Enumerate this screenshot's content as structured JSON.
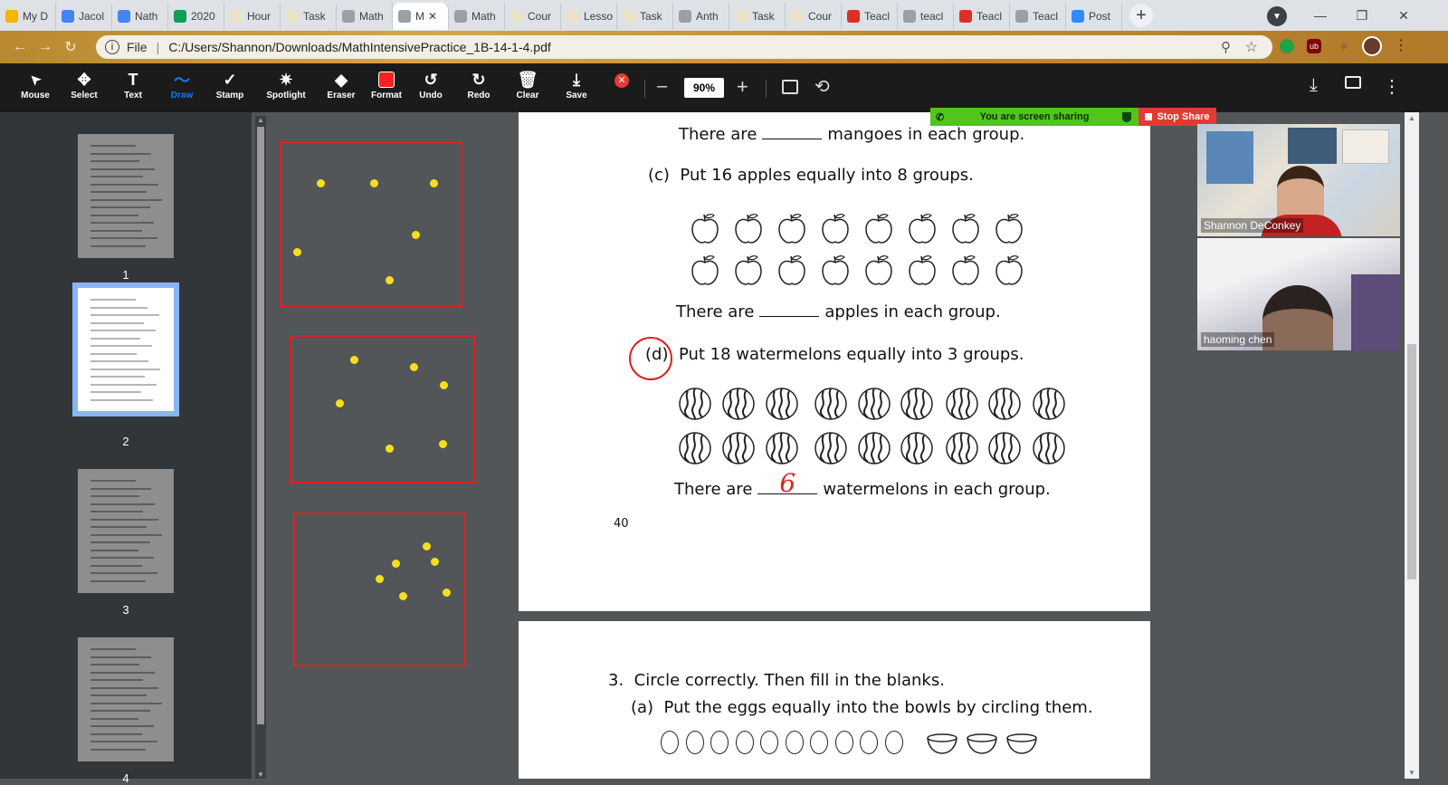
{
  "browser": {
    "tabs": [
      {
        "label": "My D",
        "color": "#f4b400"
      },
      {
        "label": "Jacol",
        "color": "#4285f4"
      },
      {
        "label": "Nath",
        "color": "#4285f4"
      },
      {
        "label": "2020",
        "color": "#0f9d58"
      },
      {
        "label": "Hour",
        "color": "#e8e2c8"
      },
      {
        "label": "Task",
        "color": "#e8e2c8"
      },
      {
        "label": "Math",
        "color": "#9aa0a6"
      },
      {
        "label": "M",
        "color": "#9aa0a6",
        "active": true
      },
      {
        "label": "Math",
        "color": "#9aa0a6"
      },
      {
        "label": "Cour",
        "color": "#e8e2c8"
      },
      {
        "label": "Lesso",
        "color": "#e8e2c8"
      },
      {
        "label": "Task",
        "color": "#e8e2c8"
      },
      {
        "label": "Anth",
        "color": "#9aa0a6"
      },
      {
        "label": "Task",
        "color": "#e8e2c8"
      },
      {
        "label": "Cour",
        "color": "#e8e2c8"
      },
      {
        "label": "Teacl",
        "color": "#d93025"
      },
      {
        "label": "teacl",
        "color": "#9aa0a6"
      },
      {
        "label": "Teacl",
        "color": "#d93025"
      },
      {
        "label": "Teacl",
        "color": "#9aa0a6"
      },
      {
        "label": "Post",
        "color": "#2d8cff"
      }
    ],
    "address_prefix": "File",
    "url": "C:/Users/Shannon/Downloads/MathIntensivePractice_1B-14-1-4.pdf"
  },
  "toolbar": {
    "tools": [
      {
        "label": "Mouse",
        "icon": "cursor-icon"
      },
      {
        "label": "Select",
        "icon": "move-icon"
      },
      {
        "label": "Text",
        "icon": "text-icon"
      },
      {
        "label": "Draw",
        "icon": "draw-icon",
        "active": true
      },
      {
        "label": "Stamp",
        "icon": "check-icon"
      },
      {
        "label": "Spotlight",
        "icon": "spotlight-icon"
      },
      {
        "label": "Eraser",
        "icon": "eraser-icon"
      },
      {
        "label": "Format",
        "icon": "format-icon"
      },
      {
        "label": "Undo",
        "icon": "undo-icon"
      },
      {
        "label": "Redo",
        "icon": "redo-icon"
      },
      {
        "label": "Clear",
        "icon": "trash-icon"
      },
      {
        "label": "Save",
        "icon": "save-icon"
      }
    ],
    "zoom": "90%",
    "minus": "–",
    "plus": "+",
    "draw_color": "#1a73e8",
    "format_color": "#ff2020"
  },
  "sidebar": {
    "pages": [
      {
        "number": "1",
        "selected": false
      },
      {
        "number": "2",
        "selected": true
      },
      {
        "number": "3",
        "selected": false
      },
      {
        "number": "4",
        "selected": false
      }
    ]
  },
  "document": {
    "mango_line": {
      "pre": "There are",
      "post": "mangoes in each group."
    },
    "c_label": "(c)",
    "c_text": "Put 16 apples equally into 8 groups.",
    "apple_line": {
      "pre": "There are",
      "post": "apples in each group."
    },
    "d_label": "(d)",
    "d_text": "Put 18 watermelons equally into 3 groups.",
    "melon_line": {
      "pre": "There are",
      "answer": "6",
      "post": "watermelons in each group."
    },
    "page_number": "40",
    "q3_label": "3.",
    "q3_text": "Circle correctly. Then fill in the blanks.",
    "q3a_label": "(a)",
    "q3a_text": "Put the eggs equally into the bowls by circling them."
  },
  "zoom": {
    "sharing_text": "You are screen sharing",
    "stop_share": "Stop Share",
    "participants": [
      {
        "name": "Shannon DeConkey"
      },
      {
        "name": "haoming chen"
      }
    ]
  }
}
